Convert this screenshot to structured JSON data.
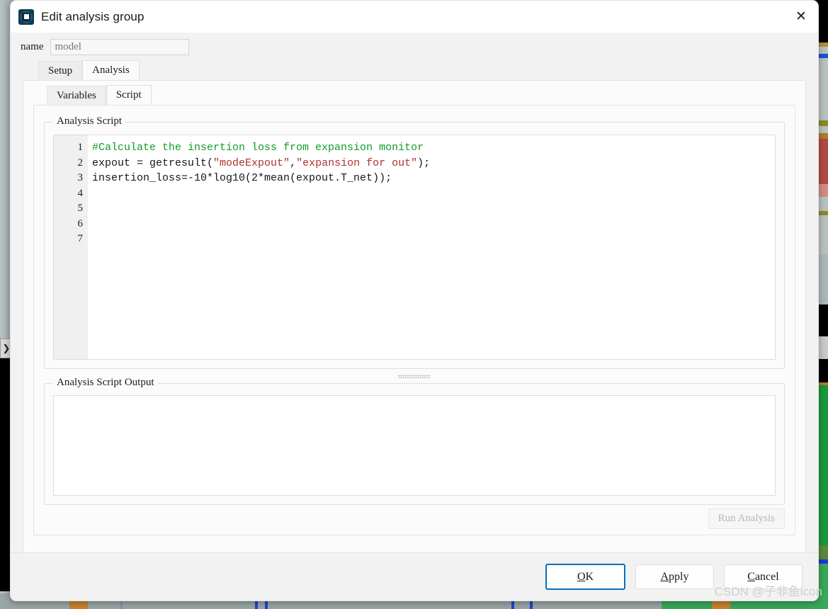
{
  "window": {
    "title": "Edit analysis group",
    "icon": "lumerical-app-icon",
    "close_label": "✕"
  },
  "name_field": {
    "label": "name",
    "value": "model",
    "placeholder": "model"
  },
  "outer_tabs": [
    {
      "label": "Setup",
      "active": false
    },
    {
      "label": "Analysis",
      "active": true
    }
  ],
  "inner_tabs": [
    {
      "label": "Variables",
      "active": false
    },
    {
      "label": "Script",
      "active": true
    }
  ],
  "script_group": {
    "title": "Analysis Script",
    "line_numbers": [
      "1",
      "2",
      "3",
      "4",
      "5",
      "6",
      "7"
    ],
    "lines": [
      {
        "number": "1",
        "tokens": [
          {
            "text": "#Calculate the insertion loss from expansion monitor",
            "type": "comment"
          }
        ]
      },
      {
        "number": "2",
        "tokens": [
          {
            "text": "expout = getresult(",
            "type": "plain"
          },
          {
            "text": "\"modeExpout\"",
            "type": "string"
          },
          {
            "text": ",",
            "type": "plain"
          },
          {
            "text": "\"expansion for out\"",
            "type": "string"
          },
          {
            "text": ");",
            "type": "plain"
          }
        ]
      },
      {
        "number": "3",
        "tokens": [
          {
            "text": "insertion_loss=-10*log10(2*mean(expout.T_net));",
            "type": "plain"
          }
        ]
      },
      {
        "number": "4",
        "tokens": []
      },
      {
        "number": "5",
        "tokens": []
      },
      {
        "number": "6",
        "tokens": []
      },
      {
        "number": "7",
        "tokens": []
      }
    ]
  },
  "output_group": {
    "title": "Analysis Script Output",
    "content": ""
  },
  "run_analysis": {
    "label": "Run Analysis",
    "enabled": false
  },
  "buttons": [
    {
      "label": "OK",
      "mnemonic": "O",
      "default": true
    },
    {
      "label": "Apply",
      "mnemonic": "A",
      "default": false
    },
    {
      "label": "Cancel",
      "mnemonic": "C",
      "default": false
    }
  ],
  "watermark": "CSDN @子非鱼icon",
  "background": {
    "left_chevron": "❯"
  },
  "colors": {
    "comment": "#0f9d28",
    "string": "#b03030",
    "accent": "#0a6ebd",
    "dialog_bg": "#f2f2f2",
    "panel_bg": "#fbfbfb"
  }
}
